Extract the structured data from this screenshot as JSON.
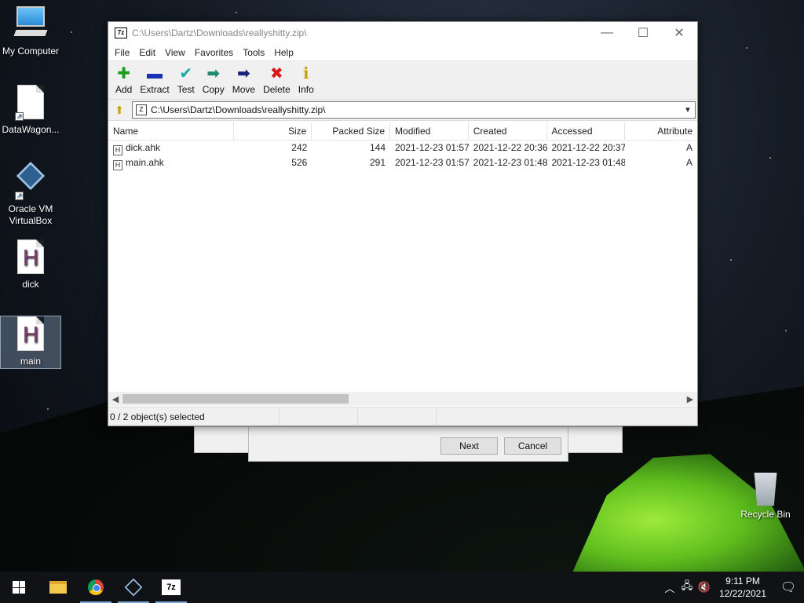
{
  "desktop": {
    "icons": [
      {
        "label": "My Computer"
      },
      {
        "label": "DataWagon..."
      },
      {
        "label": "Oracle VM VirtualBox"
      },
      {
        "label": "dick"
      },
      {
        "label": "main"
      }
    ],
    "recycle_bin": "Recycle Bin"
  },
  "window": {
    "title": "C:\\Users\\Dartz\\Downloads\\reallyshitty.zip\\",
    "app_logo": "7z",
    "menu": [
      "File",
      "Edit",
      "View",
      "Favorites",
      "Tools",
      "Help"
    ],
    "toolbar": [
      {
        "label": "Add",
        "icon": "plus-icon",
        "glyph": "✚",
        "color": "#1aa01a"
      },
      {
        "label": "Extract",
        "icon": "minus-icon",
        "glyph": "▬",
        "color": "#1a2fb4"
      },
      {
        "label": "Test",
        "icon": "check-icon",
        "glyph": "✔",
        "color": "#19a7a7"
      },
      {
        "label": "Copy",
        "icon": "copy-arrow-icon",
        "glyph": "➡",
        "color": "#1f8a6e"
      },
      {
        "label": "Move",
        "icon": "move-arrow-icon",
        "glyph": "➡",
        "color": "#1a237e"
      },
      {
        "label": "Delete",
        "icon": "delete-x-icon",
        "glyph": "✖",
        "color": "#d91a1a"
      },
      {
        "label": "Info",
        "icon": "info-icon",
        "glyph": "ℹ",
        "color": "#c9a200"
      }
    ],
    "address": "C:\\Users\\Dartz\\Downloads\\reallyshitty.zip\\",
    "columns": [
      "Name",
      "Size",
      "Packed Size",
      "Modified",
      "Created",
      "Accessed",
      "Attribute"
    ],
    "files": [
      {
        "name": "dick.ahk",
        "size": "242",
        "packed": "144",
        "modified": "2021-12-23 01:57",
        "created": "2021-12-22 20:36",
        "accessed": "2021-12-22 20:37",
        "attr": "A"
      },
      {
        "name": "main.ahk",
        "size": "526",
        "packed": "291",
        "modified": "2021-12-23 01:57",
        "created": "2021-12-23 01:48",
        "accessed": "2021-12-23 01:48",
        "attr": "A"
      }
    ],
    "status": "0 / 2 object(s) selected"
  },
  "dialog": {
    "next_label": "Next",
    "cancel_label": "Cancel"
  },
  "taskbar": {
    "time": "9:11 PM",
    "date": "12/22/2021"
  }
}
